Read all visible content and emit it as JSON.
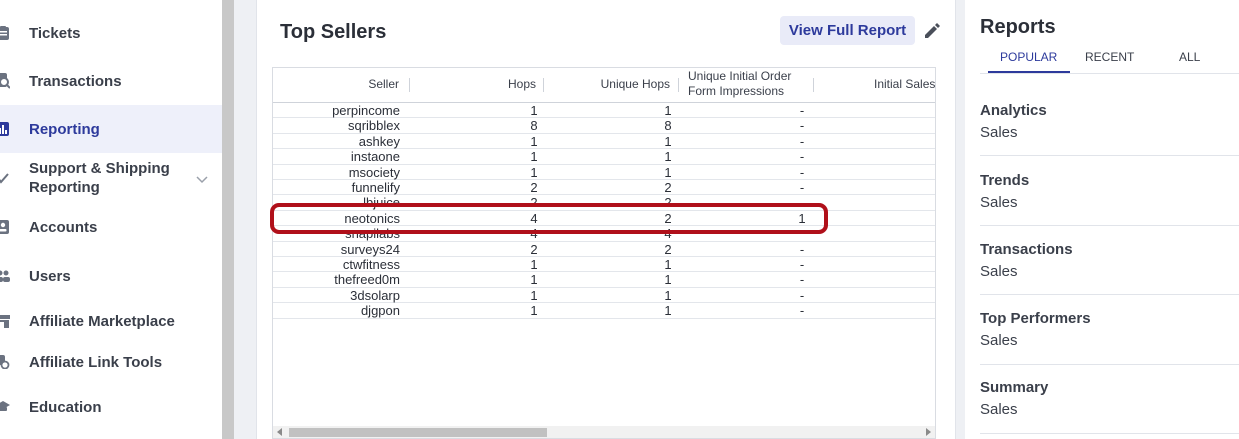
{
  "sidebar": {
    "items": [
      {
        "label": "Tickets",
        "icon": "ticket-icon"
      },
      {
        "label": "Transactions",
        "icon": "receipt-search-icon"
      },
      {
        "label": "Reporting",
        "icon": "bar-chart-icon",
        "active": true
      },
      {
        "label": "Support & Shipping",
        "label2": "Reporting",
        "icon": "check-icon"
      },
      {
        "label": "Accounts",
        "icon": "id-card-icon"
      },
      {
        "label": "Users",
        "icon": "users-icon"
      },
      {
        "label": "Affiliate Marketplace",
        "icon": "store-icon"
      },
      {
        "label": "Affiliate Link Tools",
        "icon": "link-tools-icon"
      },
      {
        "label": "Education",
        "icon": "graduation-cap-icon"
      }
    ]
  },
  "card": {
    "title": "Top Sellers",
    "view_full_report": "View Full Report",
    "table": {
      "headers": {
        "seller": "Seller",
        "hops": "Hops",
        "unique_hops": "Unique Hops",
        "uioi_line1": "Unique Initial Order",
        "uioi_line2": "Form Impressions",
        "initial_sales": "Initial Sales"
      },
      "rows": [
        {
          "seller": "perpincome",
          "hops": "1",
          "unique_hops": "1",
          "uioi": "-"
        },
        {
          "seller": "sqribblex",
          "hops": "8",
          "unique_hops": "8",
          "uioi": "-"
        },
        {
          "seller": "ashkey",
          "hops": "1",
          "unique_hops": "1",
          "uioi": "-"
        },
        {
          "seller": "instaone",
          "hops": "1",
          "unique_hops": "1",
          "uioi": "-"
        },
        {
          "seller": "msociety",
          "hops": "1",
          "unique_hops": "1",
          "uioi": "-"
        },
        {
          "seller": "funnelify",
          "hops": "2",
          "unique_hops": "2",
          "uioi": "-"
        },
        {
          "seller": "lbjuice",
          "hops": "2",
          "unique_hops": "2",
          "uioi": ""
        },
        {
          "seller": "neotonics",
          "hops": "4",
          "unique_hops": "2",
          "uioi": "1"
        },
        {
          "seller": "snapilabs",
          "hops": "4",
          "unique_hops": "4",
          "uioi": ""
        },
        {
          "seller": "surveys24",
          "hops": "2",
          "unique_hops": "2",
          "uioi": "-"
        },
        {
          "seller": "ctwfitness",
          "hops": "1",
          "unique_hops": "1",
          "uioi": "-"
        },
        {
          "seller": "thefreed0m",
          "hops": "1",
          "unique_hops": "1",
          "uioi": "-"
        },
        {
          "seller": "3dsolarp",
          "hops": "1",
          "unique_hops": "1",
          "uioi": "-"
        },
        {
          "seller": "djgpon",
          "hops": "1",
          "unique_hops": "1",
          "uioi": "-"
        }
      ]
    }
  },
  "reports": {
    "title": "Reports",
    "tabs": [
      "POPULAR",
      "RECENT",
      "ALL"
    ],
    "items": [
      {
        "name": "Analytics",
        "sub": "Sales"
      },
      {
        "name": "Trends",
        "sub": "Sales"
      },
      {
        "name": "Transactions",
        "sub": "Sales"
      },
      {
        "name": "Top Performers",
        "sub": "Sales"
      },
      {
        "name": "Summary",
        "sub": "Sales"
      }
    ]
  },
  "colors": {
    "accent": "#2d3a9c",
    "highlight_outline": "#b0101a",
    "active_bg": "#eef0fa"
  }
}
